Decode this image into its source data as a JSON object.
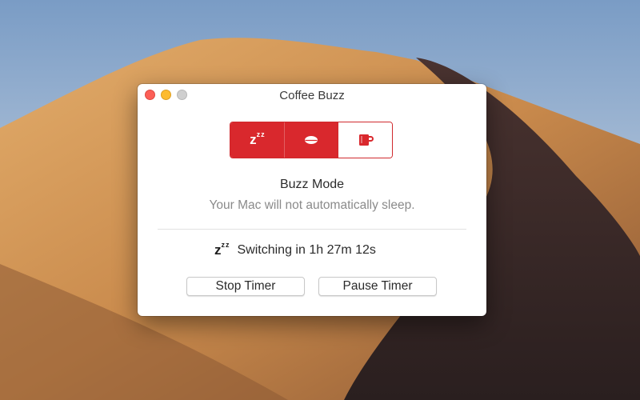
{
  "window": {
    "title": "Coffee Buzz"
  },
  "mode_selector": {
    "segments": [
      {
        "icon": "zzz-sleep-icon",
        "selected": false
      },
      {
        "icon": "pill-icon",
        "selected": false
      },
      {
        "icon": "coffee-cup-icon",
        "selected": true
      }
    ],
    "accent_color": "#d9282d"
  },
  "mode": {
    "title": "Buzz Mode",
    "description": "Your Mac will not automatically sleep."
  },
  "timer": {
    "icon": "zzz-sleep-icon",
    "status": "Switching in 1h 27m 12s"
  },
  "buttons": {
    "stop_label": "Stop Timer",
    "pause_label": "Pause Timer"
  }
}
